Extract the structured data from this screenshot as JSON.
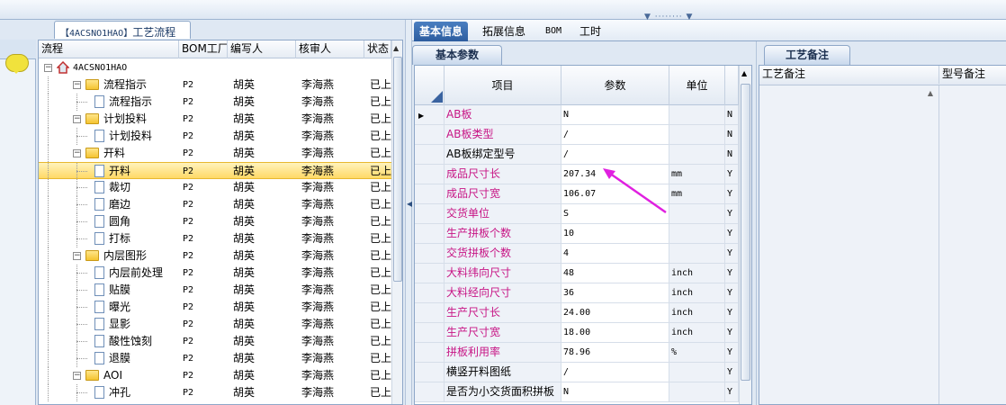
{
  "left_panel": {
    "tab_code": "【4ACSNO1HAO】",
    "tab_title": "工艺流程",
    "columns": [
      "流程",
      "BOM工厂",
      "编写人",
      "核审人",
      "状态"
    ],
    "rows": [
      {
        "name": "4ACSNO1HAO",
        "level": 0,
        "type": "root",
        "bom": "",
        "writer": "",
        "reviewer": "",
        "status": ""
      },
      {
        "name": "流程指示",
        "level": 1,
        "type": "folder",
        "bom": "P2",
        "writer": "胡英",
        "reviewer": "李海燕",
        "status": "已上"
      },
      {
        "name": "流程指示",
        "level": 2,
        "type": "doc",
        "bom": "P2",
        "writer": "胡英",
        "reviewer": "李海燕",
        "status": "已上"
      },
      {
        "name": "计划投料",
        "level": 1,
        "type": "folder",
        "bom": "P2",
        "writer": "胡英",
        "reviewer": "李海燕",
        "status": "已上"
      },
      {
        "name": "计划投料",
        "level": 2,
        "type": "doc",
        "bom": "P2",
        "writer": "胡英",
        "reviewer": "李海燕",
        "status": "已上"
      },
      {
        "name": "开料",
        "level": 1,
        "type": "folder",
        "bom": "P2",
        "writer": "胡英",
        "reviewer": "李海燕",
        "status": "已上"
      },
      {
        "name": "开料",
        "level": 2,
        "type": "doc",
        "bom": "P2",
        "writer": "胡英",
        "reviewer": "李海燕",
        "status": "已上",
        "selected": true
      },
      {
        "name": "裁切",
        "level": 2,
        "type": "doc",
        "bom": "P2",
        "writer": "胡英",
        "reviewer": "李海燕",
        "status": "已上"
      },
      {
        "name": "磨边",
        "level": 2,
        "type": "doc",
        "bom": "P2",
        "writer": "胡英",
        "reviewer": "李海燕",
        "status": "已上"
      },
      {
        "name": "圆角",
        "level": 2,
        "type": "doc",
        "bom": "P2",
        "writer": "胡英",
        "reviewer": "李海燕",
        "status": "已上"
      },
      {
        "name": "打标",
        "level": 2,
        "type": "doc",
        "bom": "P2",
        "writer": "胡英",
        "reviewer": "李海燕",
        "status": "已上"
      },
      {
        "name": "内层图形",
        "level": 1,
        "type": "folder",
        "bom": "P2",
        "writer": "胡英",
        "reviewer": "李海燕",
        "status": "已上"
      },
      {
        "name": "内层前处理",
        "level": 2,
        "type": "doc",
        "bom": "P2",
        "writer": "胡英",
        "reviewer": "李海燕",
        "status": "已上"
      },
      {
        "name": "贴膜",
        "level": 2,
        "type": "doc",
        "bom": "P2",
        "writer": "胡英",
        "reviewer": "李海燕",
        "status": "已上"
      },
      {
        "name": "曝光",
        "level": 2,
        "type": "doc",
        "bom": "P2",
        "writer": "胡英",
        "reviewer": "李海燕",
        "status": "已上"
      },
      {
        "name": "显影",
        "level": 2,
        "type": "doc",
        "bom": "P2",
        "writer": "胡英",
        "reviewer": "李海燕",
        "status": "已上"
      },
      {
        "name": "酸性蚀刻",
        "level": 2,
        "type": "doc",
        "bom": "P2",
        "writer": "胡英",
        "reviewer": "李海燕",
        "status": "已上"
      },
      {
        "name": "退膜",
        "level": 2,
        "type": "doc",
        "bom": "P2",
        "writer": "胡英",
        "reviewer": "李海燕",
        "status": "已上"
      },
      {
        "name": "AOI",
        "level": 1,
        "type": "folder",
        "bom": "P2",
        "writer": "胡英",
        "reviewer": "李海燕",
        "status": "已上"
      },
      {
        "name": "冲孔",
        "level": 2,
        "type": "doc",
        "bom": "P2",
        "writer": "胡英",
        "reviewer": "李海燕",
        "status": "已上"
      }
    ]
  },
  "right_tabs": [
    "基本信息",
    "拓展信息",
    "BOM",
    "工时"
  ],
  "param_panel": {
    "tab": "基本参数",
    "columns": [
      "项目",
      "参数",
      "单位"
    ],
    "rows": [
      {
        "name": "AB板",
        "value": "N",
        "unit": "",
        "flag": "N",
        "pink": true,
        "current": true
      },
      {
        "name": "AB板类型",
        "value": "/",
        "unit": "",
        "flag": "N",
        "pink": true
      },
      {
        "name": "AB板绑定型号",
        "value": "/",
        "unit": "",
        "flag": "N",
        "pink": false
      },
      {
        "name": "成品尺寸长",
        "value": "207.34",
        "unit": "mm",
        "flag": "Y",
        "pink": true
      },
      {
        "name": "成品尺寸宽",
        "value": "106.07",
        "unit": "mm",
        "flag": "Y",
        "pink": true
      },
      {
        "name": "交货单位",
        "value": "S",
        "unit": "",
        "flag": "Y",
        "pink": true
      },
      {
        "name": "生产拼板个数",
        "value": "10",
        "unit": "",
        "flag": "Y",
        "pink": true
      },
      {
        "name": "交货拼板个数",
        "value": "4",
        "unit": "",
        "flag": "Y",
        "pink": true
      },
      {
        "name": "大料纬向尺寸",
        "value": "48",
        "unit": "inch",
        "flag": "Y",
        "pink": true
      },
      {
        "name": "大料经向尺寸",
        "value": "36",
        "unit": "inch",
        "flag": "Y",
        "pink": true
      },
      {
        "name": "生产尺寸长",
        "value": "24.00",
        "unit": "inch",
        "flag": "Y",
        "pink": true
      },
      {
        "name": "生产尺寸宽",
        "value": "18.00",
        "unit": "inch",
        "flag": "Y",
        "pink": true
      },
      {
        "name": "拼板利用率",
        "value": "78.96",
        "unit": "%",
        "flag": "Y",
        "pink": true
      },
      {
        "name": "横竖开料图纸",
        "value": "/",
        "unit": "",
        "flag": "Y",
        "pink": false
      },
      {
        "name": "是否为小交货面积拼板",
        "value": "N",
        "unit": "",
        "flag": "Y",
        "pink": false
      }
    ]
  },
  "notes_panel": {
    "tab": "工艺备注",
    "columns": [
      "工艺备注",
      "型号备注"
    ]
  },
  "colors": {
    "pink_label": "#c71585",
    "arrow": "#e020e0",
    "selected_row": "#ffd966",
    "active_tab": "#2d5d9f"
  }
}
